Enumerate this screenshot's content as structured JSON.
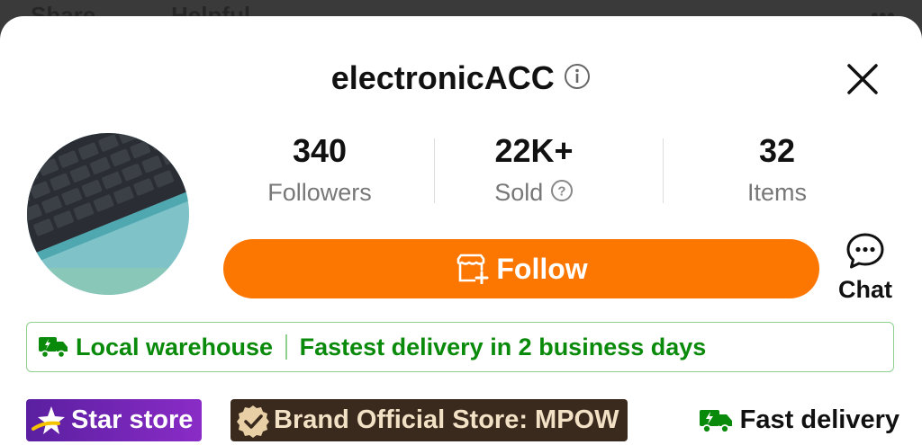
{
  "background_tab": {
    "share_label": "Share",
    "helpful_label": "Helpful"
  },
  "header": {
    "store_name": "electronicACC"
  },
  "stats": [
    {
      "value": "340",
      "label": "Followers"
    },
    {
      "value": "22K+",
      "label": "Sold"
    },
    {
      "value": "32",
      "label": "Items"
    }
  ],
  "actions": {
    "follow_label": "Follow",
    "chat_label": "Chat"
  },
  "warehouse": {
    "label": "Local warehouse",
    "delivery_text": "Fastest delivery in 2 business days"
  },
  "badges": {
    "star_store": "Star store",
    "brand_official": "Brand Official Store: MPOW",
    "fast_delivery": "Fast delivery"
  },
  "colors": {
    "accent": "#fb7701",
    "green": "#0a8a0a",
    "star_purple": "#6a24b0",
    "brand_brown": "#3a2a1e"
  },
  "icons": [
    "info-icon",
    "close-icon",
    "question-icon",
    "store-plus-icon",
    "chat-bubble-icon",
    "truck-icon",
    "star-icon",
    "verified-badge-icon"
  ]
}
